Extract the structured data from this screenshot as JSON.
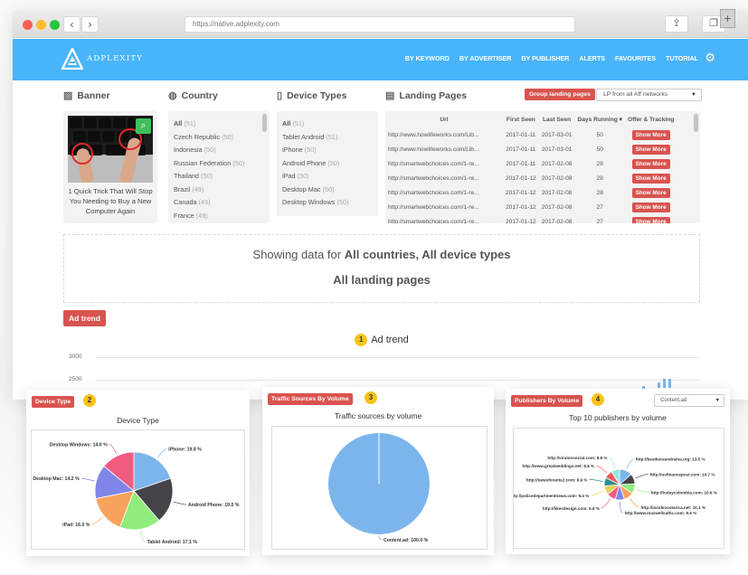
{
  "browser": {
    "url": "https://native.adplexity.com",
    "back_icon": "‹",
    "forward_icon": "›",
    "share_icon": "⇪",
    "tabs_icon": "❐",
    "new_tab_icon": "+"
  },
  "app": {
    "logo_text": "ADPLEXITY",
    "nav": [
      "BY KEYWORD",
      "BY ADVERTISER",
      "BY PUBLISHER",
      "ALERTS",
      "FAVOURITES",
      "TUTORIAL"
    ],
    "settings_icon": "⚙",
    "accent_color": "#48b4fa",
    "button_color": "#d9534f"
  },
  "banner": {
    "title": "Banner",
    "caption": "1 Quick Trick That Will Stop You Needing to Buy a New Computer Again"
  },
  "country": {
    "title": "Country",
    "items": [
      {
        "name": "All",
        "count": "(51)"
      },
      {
        "name": "Czech Republic",
        "count": "(50)"
      },
      {
        "name": "Indonesia",
        "count": "(50)"
      },
      {
        "name": "Russian Federation",
        "count": "(50)"
      },
      {
        "name": "Thailand",
        "count": "(50)"
      },
      {
        "name": "Brazil",
        "count": "(49)"
      },
      {
        "name": "Canada",
        "count": "(49)"
      },
      {
        "name": "France",
        "count": "(49)"
      }
    ]
  },
  "device_types": {
    "title": "Device Types",
    "items": [
      {
        "name": "All",
        "count": "(51)"
      },
      {
        "name": "Tablet Android",
        "count": "(51)"
      },
      {
        "name": "iPhone",
        "count": "(50)"
      },
      {
        "name": "Android Phone",
        "count": "(50)"
      },
      {
        "name": "iPad",
        "count": "(50)"
      },
      {
        "name": "Desktop Mac",
        "count": "(50)"
      },
      {
        "name": "Desktop Windows",
        "count": "(50)"
      }
    ]
  },
  "landing_pages": {
    "title": "Landing Pages",
    "group_button": "Group landing pages",
    "network_select": "LP from all Aff networks",
    "columns": [
      "Url",
      "First Seen",
      "Last Seen",
      "Days Running ▾",
      "Offer & Tracking"
    ],
    "show_more_label": "Show More",
    "rows": [
      {
        "url": "http://www.howlifeworks.com/Lib...",
        "first": "2017-01-11",
        "last": "2017-03-01",
        "days": "50"
      },
      {
        "url": "http://www.howlifeworks.com/Lib...",
        "first": "2017-01-11",
        "last": "2017-03-01",
        "days": "50"
      },
      {
        "url": "http://smartwebchoices.com/1-re...",
        "first": "2017-01-11",
        "last": "2017-02-08",
        "days": "28"
      },
      {
        "url": "http://smartwebchoices.com/1-re...",
        "first": "2017-01-12",
        "last": "2017-02-08",
        "days": "28"
      },
      {
        "url": "http://smartwebchoices.com/1-re...",
        "first": "2017-01-12",
        "last": "2017-02-08",
        "days": "28"
      },
      {
        "url": "http://smartwebchoices.com/1-re...",
        "first": "2017-01-12",
        "last": "2017-02-08",
        "days": "27"
      },
      {
        "url": "http://smartwebchoices.com/1-re...",
        "first": "2017-01-12",
        "last": "2017-02-08",
        "days": "27"
      }
    ]
  },
  "summary": {
    "prefix": "Showing data for ",
    "bold": "All countries, All device types",
    "line2": "All landing pages"
  },
  "ad_trend": {
    "button": "Ad trend",
    "badge": "1",
    "title": "Ad trend",
    "yticks": [
      "3000",
      "2500"
    ]
  },
  "device_card": {
    "button": "Device Type",
    "badge": "2",
    "title": "Device Type"
  },
  "traffic_card": {
    "button": "Traffic Sources By Volume",
    "badge": "3",
    "title": "Traffic sources by volume"
  },
  "publishers_card": {
    "button": "Publishers By Volume",
    "badge": "4",
    "title": "Top 10 publishers by volume",
    "select": "Content.ad"
  },
  "chart_data": [
    {
      "type": "pie",
      "title": "Device Type",
      "labels": [
        "iPhone",
        "Android Phone",
        "Tablet Android",
        "iPad",
        "Desktop Mac",
        "Desktop Windows"
      ],
      "values": [
        19.8,
        19.0,
        17.1,
        16.0,
        14.2,
        14.0
      ],
      "colors": [
        "#7cb5ec",
        "#434348",
        "#90ed7d",
        "#f7a35c",
        "#8085e9",
        "#f15c80"
      ]
    },
    {
      "type": "pie",
      "title": "Traffic sources by volume",
      "labels": [
        "Content.ad"
      ],
      "values": [
        100.0
      ],
      "colors": [
        "#7cb5ec"
      ]
    },
    {
      "type": "pie",
      "title": "Top 10 publishers by volume",
      "labels": [
        "http://bestkoreandrama.org",
        "http://usfinancepost.com",
        "http://todaycolombia.com",
        "http://insidecostarica.net",
        "http://www.maxwellsattic.com",
        "http://likesdesign.com",
        "http://policedepartmentnews.com",
        "http://newsforants2.com",
        "http://www.greatweddings.net",
        "http://viralonsocial.com"
      ],
      "values": [
        13.5,
        10.7,
        10.6,
        10.1,
        9.6,
        9.6,
        9.4,
        8.9,
        8.8,
        8.8
      ],
      "colors": [
        "#7cb5ec",
        "#434348",
        "#90ed7d",
        "#f7a35c",
        "#8085e9",
        "#f15c80",
        "#e4d354",
        "#2b908f",
        "#f45b5b",
        "#91e8e1"
      ]
    }
  ]
}
